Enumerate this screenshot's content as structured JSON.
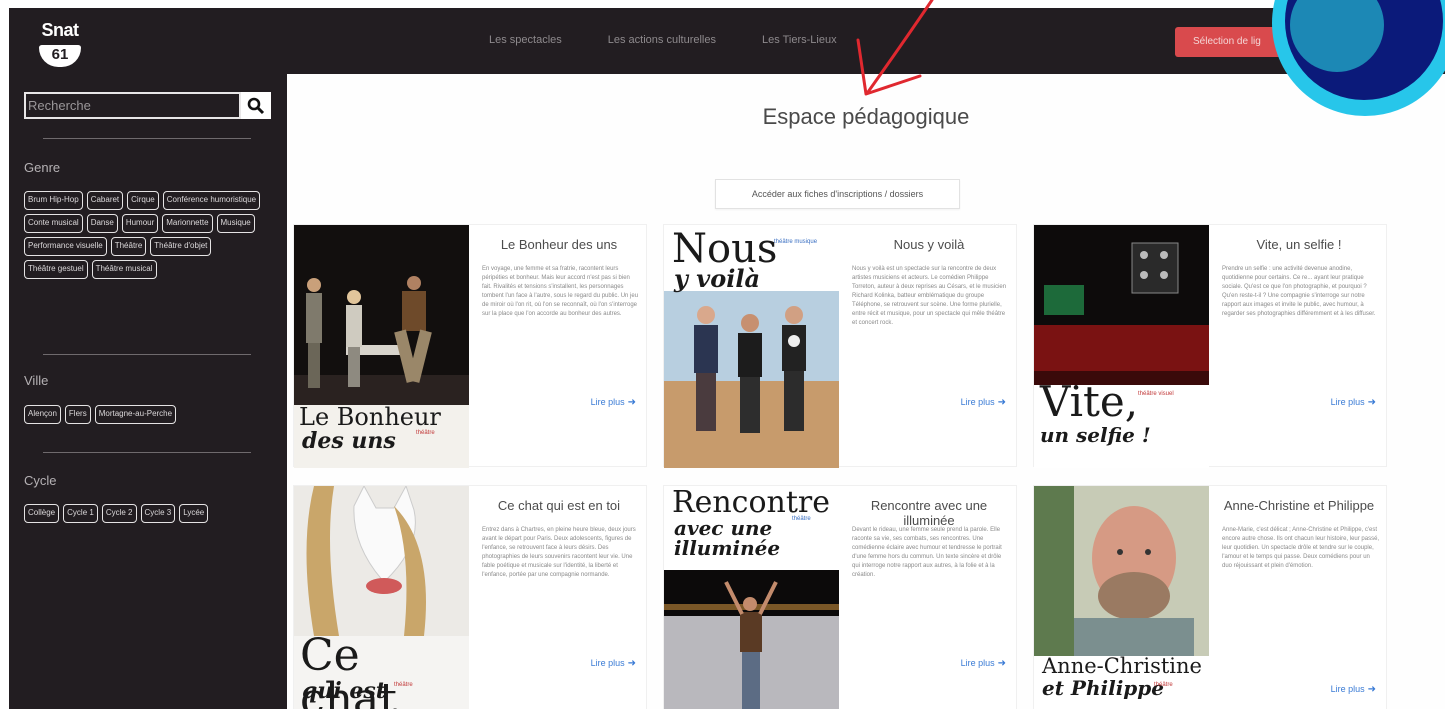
{
  "header": {
    "logo_top": "Snat",
    "logo_badge": "61",
    "nav": [
      "Les spectacles",
      "Les actions culturelles",
      "Les Tiers-Lieux"
    ],
    "cta_label": "Sélection de lig"
  },
  "sidebar": {
    "search": {
      "placeholder": "Recherche"
    },
    "sections": [
      {
        "title": "Genre",
        "tags": [
          "Brum Hip-Hop",
          "Cabaret",
          "Cirque",
          "Conférence humoristique",
          "Conte musical",
          "Danse",
          "Humour",
          "Marionnette",
          "Musique",
          "Performance visuelle",
          "Théâtre",
          "Théâtre d'objet",
          "Théâtre gestuel",
          "Théâtre musical"
        ]
      },
      {
        "title": "Ville",
        "tags": [
          "Alençon",
          "Flers",
          "Mortagne-au-Perche"
        ]
      },
      {
        "title": "Cycle",
        "tags": [
          "Collège",
          "Cycle 1",
          "Cycle 2",
          "Cycle 3",
          "Lycée"
        ]
      }
    ]
  },
  "main": {
    "title": "Espace pédagogique",
    "access_label": "Accéder aux fiches d'inscriptions / dossiers",
    "more_label": "Lire plus",
    "cards": [
      {
        "title": "Le Bonheur des uns",
        "text": "En voyage, une femme et sa fratrie, racontent leurs péripéties et bonheur. Mais leur accord n'est pas si bien fait. Rivalités et tensions s'installent, les personnages tombent l'un face à l'autre, sous le regard du public. Un jeu de miroir où l'on rit, où l'on se reconnaît, où l'on s'interroge sur la place que l'on accorde au bonheur des autres.",
        "poster_title": "Le Bonheur",
        "poster_sub": "des uns",
        "poster_tag": "théâtre"
      },
      {
        "title": "Nous y voilà",
        "text": "Nous y voilà est un spectacle sur la rencontre de deux artistes musiciens et acteurs. Le comédien Philippe Torreton, auteur à deux reprises au Césars, et le musicien Richard Kolinka, batteur emblématique du groupe Téléphone, se retrouvent sur scène. Une forme plurielle, entre récit et musique, pour un spectacle qui mêle théâtre et concert rock.",
        "poster_title": "Nous",
        "poster_sub": "y voilà",
        "poster_tag": "théâtre musique"
      },
      {
        "title": "Vite, un selfie !",
        "text": "Prendre un selfie : une activité devenue anodine, quotidienne pour certains. Ce re... ayant leur pratique sociale. Qu'est ce que l'on photographie, et pourquoi ? Qu'en reste-t-il ? Une compagnie s'interroge sur notre rapport aux images et invite le public, avec humour, à regarder ses photographies différemment et à les diffuser.",
        "poster_title": "Vite,",
        "poster_sub": "un selfie !",
        "poster_tag": "théâtre visuel"
      },
      {
        "title": "Ce chat qui est en toi",
        "text": "Entrez dans à Chartres, en pleine heure bleue, deux jours avant le départ pour Paris. Deux adolescents, figures de l'enfance, se retrouvent face à leurs désirs. Des photographies de leurs souvenirs racontent leur vie. Une fable poétique et musicale sur l'identité, la liberté et l'enfance, portée par une compagnie normande.",
        "poster_title": "Ce chat",
        "poster_sub": "qui est",
        "poster_tag": "théâtre"
      },
      {
        "title": "Rencontre avec une illuminée",
        "text": "Devant le rideau, une femme seule prend la parole. Elle raconte sa vie, ses combats, ses rencontres. Une comédienne éclaire avec humour et tendresse le portrait d'une femme hors du commun. Un texte sincère et drôle qui interroge notre rapport aux autres, à la folie et à la création.",
        "poster_title": "Rencontre",
        "poster_sub": "avec une illuminée",
        "poster_tag": "théâtre"
      },
      {
        "title": "Anne-Christine et Philippe",
        "text": "Anne-Marie, c'est délicat ; Anne-Christine et Philippe, c'est encore autre chose. Ils ont chacun leur histoire, leur passé, leur quotidien. Un spectacle drôle et tendre sur le couple, l'amour et le temps qui passe. Deux comédiens pour un duo réjouissant et plein d'émotion.",
        "poster_title": "Anne-Christine",
        "poster_sub": "et Philippe",
        "poster_tag": "théâtre"
      }
    ]
  },
  "colors": {
    "dark": "#221d21",
    "accent": "#d94a4d",
    "link": "#3a7bd5",
    "circle_outer": "#27c6ea",
    "circle_inner": "#0b1a7a"
  },
  "icons": {
    "search": "search-icon",
    "arrow": "arrow-right-icon",
    "annotation": "red-annotation-arrow"
  }
}
